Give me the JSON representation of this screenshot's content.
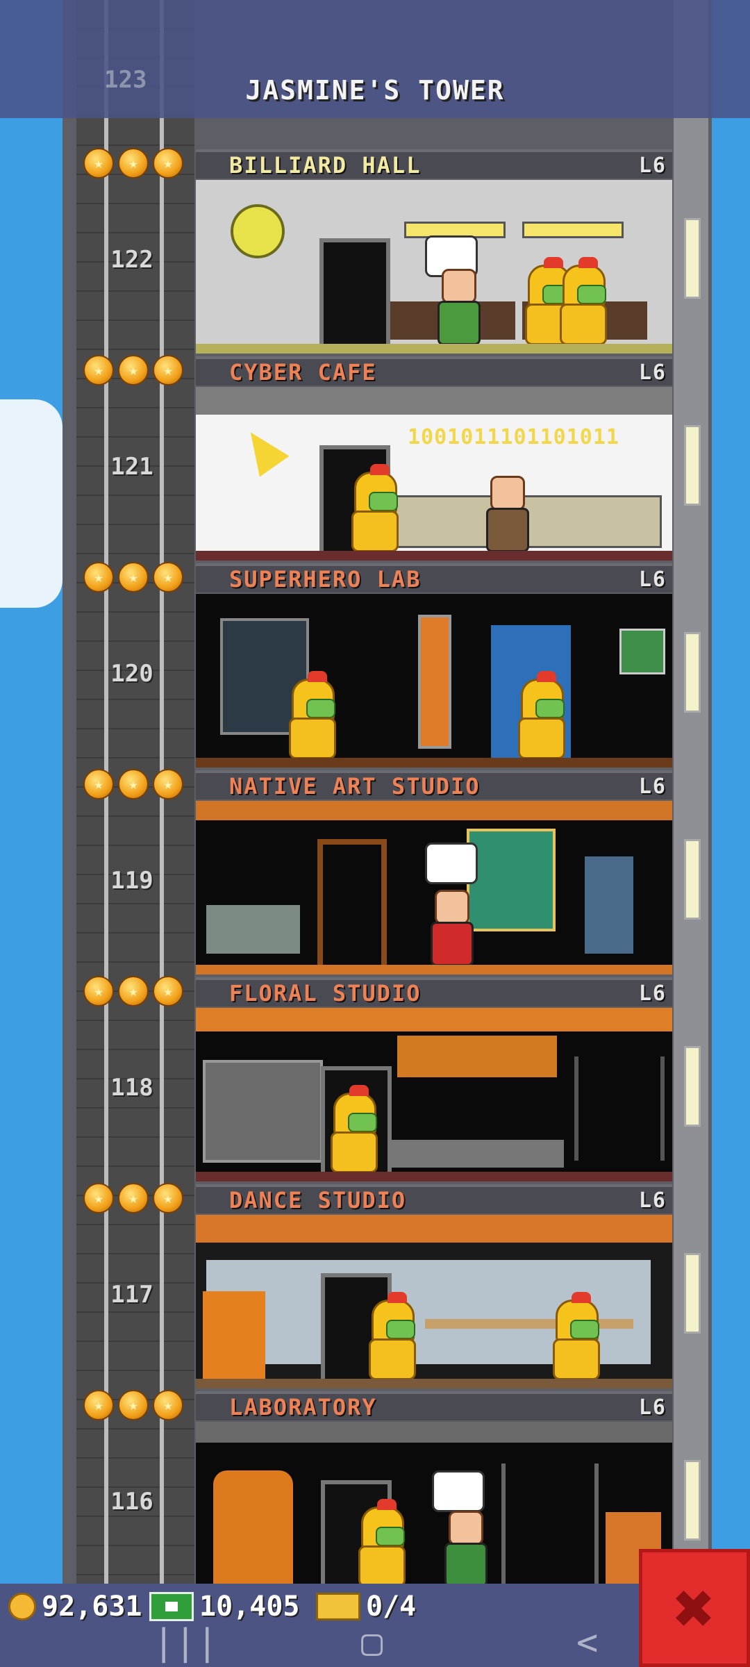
{
  "header": {
    "tower_name": "JASMINE'S TOWER",
    "partial_floor_number": "123"
  },
  "colors": {
    "sky": "#3d9ee3",
    "floor_name_first": "#f3eaa2",
    "floor_name_other": "#ef8255",
    "top_bar": "#4a5487",
    "close_button": "#e32d2d"
  },
  "floors": [
    {
      "number": "122",
      "name": "BILLIARD HALL",
      "level": "L6",
      "stars": 3,
      "scene": "billiard"
    },
    {
      "number": "121",
      "name": "CYBER CAFE",
      "level": "L6",
      "stars": 3,
      "scene": "cyber",
      "screen_text": "1001011101101011"
    },
    {
      "number": "120",
      "name": "SUPERHERO LAB",
      "level": "L6",
      "stars": 3,
      "scene": "hero"
    },
    {
      "number": "119",
      "name": "NATIVE ART STUDIO",
      "level": "L6",
      "stars": 3,
      "scene": "native"
    },
    {
      "number": "118",
      "name": "FLORAL STUDIO",
      "level": "L6",
      "stars": 3,
      "scene": "floral"
    },
    {
      "number": "117",
      "name": "DANCE STUDIO",
      "level": "L6",
      "stars": 3,
      "scene": "dance"
    },
    {
      "number": "116",
      "name": "LABORATORY",
      "level": "L6",
      "stars": 3,
      "scene": "lab"
    }
  ],
  "status": {
    "coins": "92,631",
    "bux": "10,405",
    "tickets": "0/4"
  },
  "icons": {
    "coins": "coin-icon",
    "bux": "tower-bux-icon",
    "tickets": "ticket-icon",
    "close": "close-x-icon",
    "star": "star-icon",
    "nav_recents": "recents-icon",
    "nav_home": "home-icon",
    "nav_back": "back-icon"
  }
}
